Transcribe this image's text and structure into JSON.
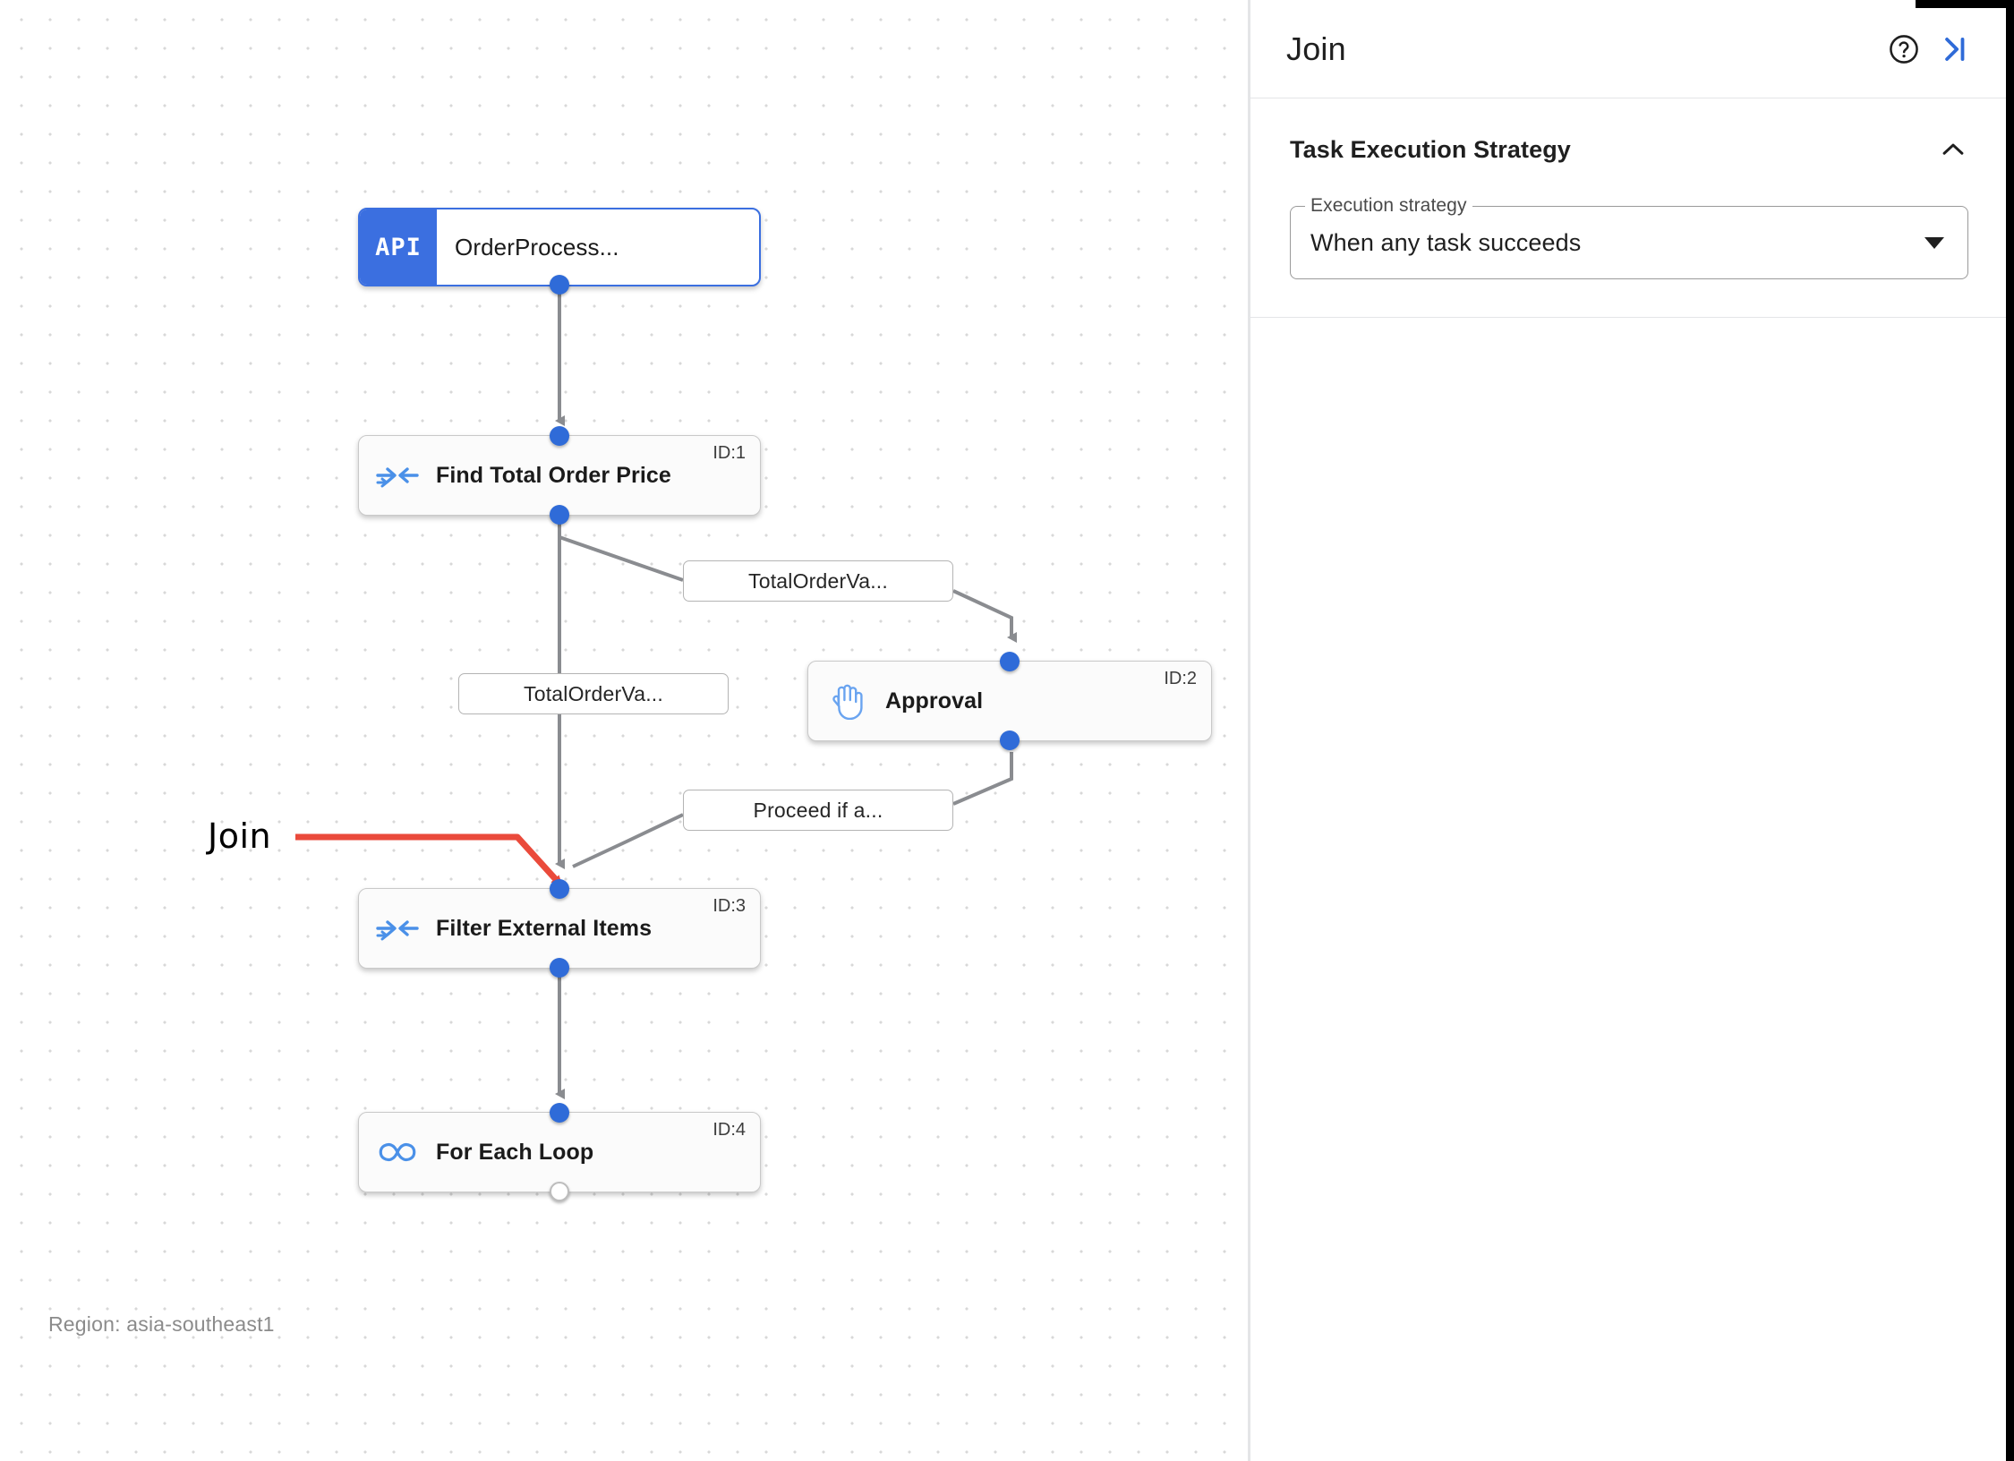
{
  "canvas": {
    "region_label": "Region: asia-southeast1",
    "annotation": {
      "label": "Join",
      "arrow_color": "#ea4a3b"
    },
    "nodes": [
      {
        "id": "trigger",
        "icon": "api-icon",
        "icon_text": "API",
        "title": "OrderProcess...",
        "id_label": "",
        "selected": true
      },
      {
        "id": "task-1",
        "icon": "merge-arrows-icon",
        "title": "Find Total Order Price",
        "id_label": "ID:1",
        "selected": false
      },
      {
        "id": "task-2",
        "icon": "raised-hand-icon",
        "title": "Approval",
        "id_label": "ID:2",
        "selected": false
      },
      {
        "id": "task-3",
        "icon": "merge-arrows-icon",
        "title": "Filter External Items",
        "id_label": "ID:3",
        "selected": false
      },
      {
        "id": "task-4",
        "icon": "infinity-loop-icon",
        "title": "For Each Loop",
        "id_label": "ID:4",
        "selected": false
      }
    ],
    "edge_labels": [
      {
        "id": "edge-label-1",
        "text": "TotalOrderVa..."
      },
      {
        "id": "edge-label-2",
        "text": "TotalOrderVa..."
      },
      {
        "id": "edge-label-3",
        "text": "Proceed if a..."
      }
    ]
  },
  "panel": {
    "title": "Join",
    "help_icon": "help-circle-icon",
    "collapse_icon": "collapse-panel-icon",
    "section": {
      "title": "Task Execution Strategy",
      "chevron_icon": "chevron-up-icon",
      "field": {
        "legend": "Execution strategy",
        "value": "When any task succeeds",
        "caret_icon": "caret-down-icon"
      }
    }
  },
  "colors": {
    "accent": "#3b6fe0",
    "port": "#2f6bd8",
    "annotation": "#ea4a3b",
    "edge": "#7f8185",
    "link": "#2f6bd8"
  }
}
